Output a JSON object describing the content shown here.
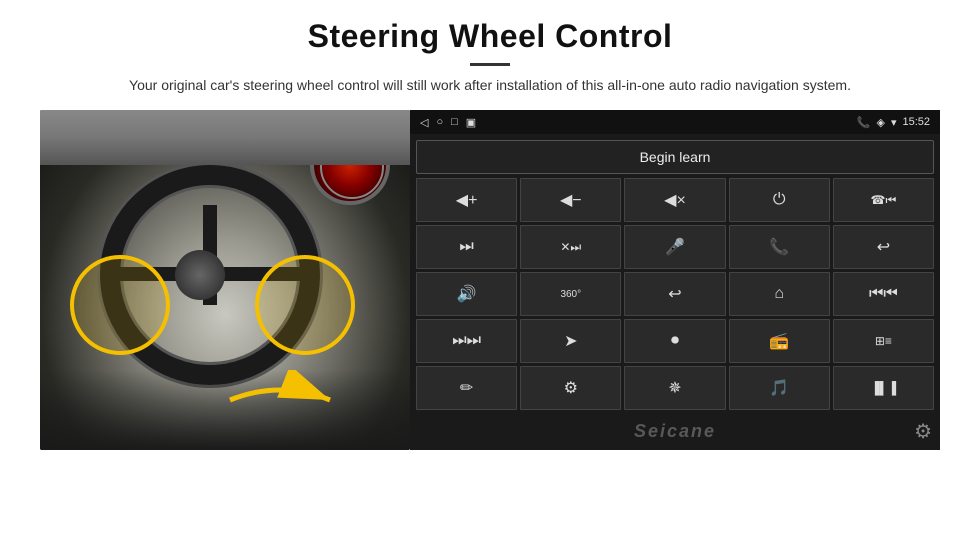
{
  "page": {
    "title": "Steering Wheel Control",
    "subtitle": "Your original car's steering wheel control will still work after installation of this all-in-one auto radio navigation system.",
    "divider": ""
  },
  "android": {
    "status_bar": {
      "back_icon": "◁",
      "home_icon": "○",
      "recent_icon": "□",
      "signal_icon": "▣",
      "phone_icon": "📞",
      "location_icon": "◈",
      "wifi_icon": "▾",
      "time": "15:52"
    },
    "begin_learn_label": "Begin learn",
    "icons": [
      {
        "symbol": "◀+",
        "name": "vol-up"
      },
      {
        "symbol": "◀−",
        "name": "vol-down"
      },
      {
        "symbol": "◀×",
        "name": "mute"
      },
      {
        "symbol": "⏻",
        "name": "power"
      },
      {
        "symbol": "↩⏮",
        "name": "prev-track"
      },
      {
        "symbol": "⏭",
        "name": "next"
      },
      {
        "symbol": "✕⏭",
        "name": "skip"
      },
      {
        "symbol": "🎤",
        "name": "mic"
      },
      {
        "symbol": "📞",
        "name": "call"
      },
      {
        "symbol": "↩",
        "name": "hang-up"
      },
      {
        "symbol": "📢",
        "name": "speaker"
      },
      {
        "symbol": "⟳",
        "name": "360"
      },
      {
        "symbol": "↩",
        "name": "back"
      },
      {
        "symbol": "⌂",
        "name": "home"
      },
      {
        "symbol": "⏮⏮",
        "name": "rewind"
      },
      {
        "symbol": "⏭⏭",
        "name": "fast-forward"
      },
      {
        "symbol": "➤",
        "name": "nav"
      },
      {
        "symbol": "⏺",
        "name": "media"
      },
      {
        "symbol": "📻",
        "name": "radio"
      },
      {
        "symbol": "≡",
        "name": "eq"
      },
      {
        "symbol": "✏",
        "name": "pen"
      },
      {
        "symbol": "⚙",
        "name": "settings"
      },
      {
        "symbol": "✵",
        "name": "bluetooth"
      },
      {
        "symbol": "♫",
        "name": "music"
      },
      {
        "symbol": "▐▌▐",
        "name": "spectrum"
      }
    ],
    "watermark": "Seicane",
    "gear_icon": "⚙"
  },
  "car_image": {
    "alt": "Steering wheel with highlighted control buttons"
  }
}
